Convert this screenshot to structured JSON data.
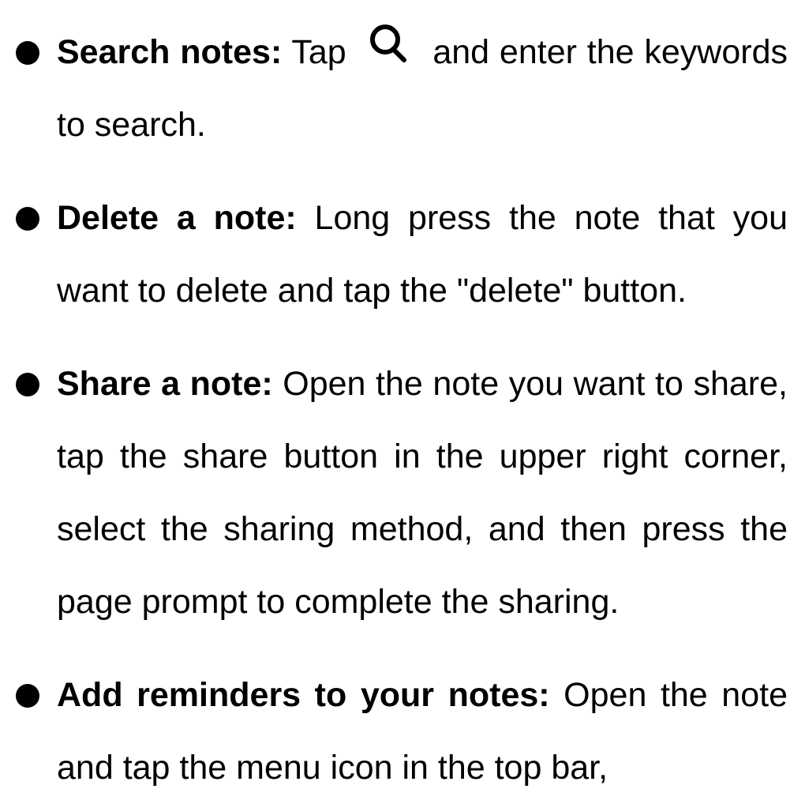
{
  "items": [
    {
      "term": "Search notes:",
      "text_before_icon": " Tap ",
      "icon": "search-icon",
      "text_after_icon": " and enter the keywords to search."
    },
    {
      "term": "Delete a note:",
      "text": " Long press the note that you want to delete and tap the \"delete\" button."
    },
    {
      "term": "Share a note:",
      "text": " Open the note you want to share, tap the share button in the upper right corner, select the sharing method, and then press the page prompt to complete the sharing."
    },
    {
      "term": "Add reminders to your notes:",
      "text": " Open the note and tap the menu icon in the top bar,"
    }
  ]
}
